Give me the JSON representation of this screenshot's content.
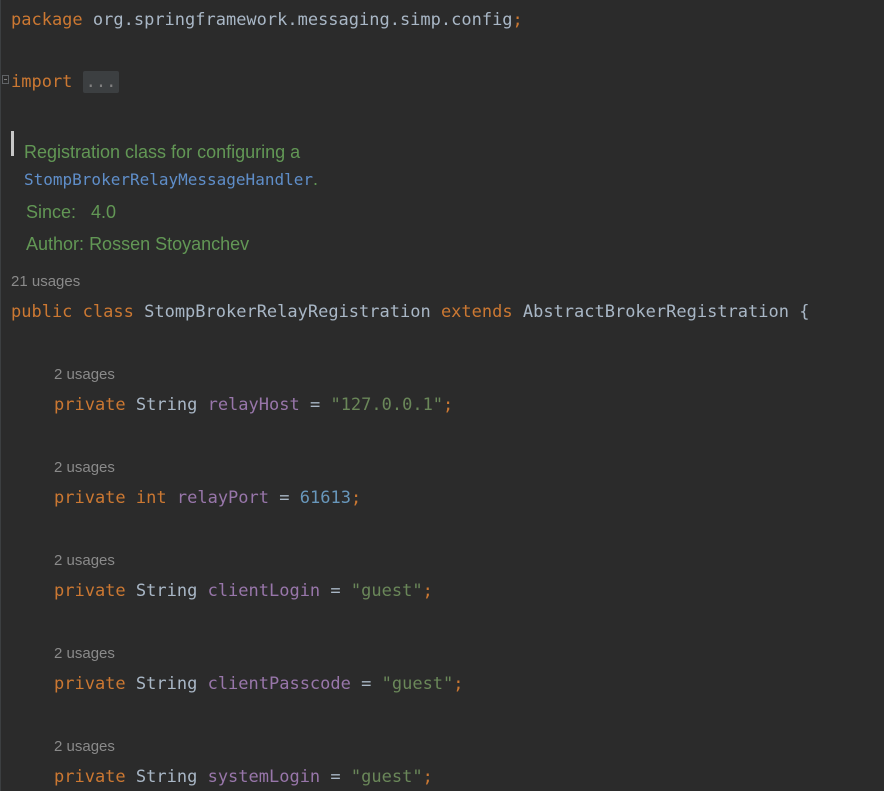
{
  "package_line": {
    "keyword": "package",
    "name": "org.springframework.messaging.simp.config",
    "semicolon": ";"
  },
  "import_line": {
    "keyword": "import",
    "collapsed": "..."
  },
  "javadoc": {
    "line1": "Registration class for configuring a",
    "link": "StompBrokerRelayMessageHandler",
    "link_suffix": ".",
    "since_label": "Since:",
    "since_value": "4.0",
    "author_label": "Author:",
    "author_value": "Rossen Stoyanchev"
  },
  "class_decl": {
    "usages": "21 usages",
    "public": "public",
    "class": "class",
    "name": "StompBrokerRelayRegistration",
    "extends": "extends",
    "parent": "AbstractBrokerRegistration",
    "brace": "{"
  },
  "fields": [
    {
      "usages": "2 usages",
      "modifier": "private",
      "type": "String",
      "type_kind": "class",
      "name": "relayHost",
      "eq": "=",
      "value": "\"127.0.0.1\"",
      "value_kind": "string",
      "semicolon": ";"
    },
    {
      "usages": "2 usages",
      "modifier": "private",
      "type": "int",
      "type_kind": "keyword",
      "name": "relayPort",
      "eq": "=",
      "value": "61613",
      "value_kind": "number",
      "semicolon": ";"
    },
    {
      "usages": "2 usages",
      "modifier": "private",
      "type": "String",
      "type_kind": "class",
      "name": "clientLogin",
      "eq": "=",
      "value": "\"guest\"",
      "value_kind": "string",
      "semicolon": ";"
    },
    {
      "usages": "2 usages",
      "modifier": "private",
      "type": "String",
      "type_kind": "class",
      "name": "clientPasscode",
      "eq": "=",
      "value": "\"guest\"",
      "value_kind": "string",
      "semicolon": ";"
    },
    {
      "usages": "2 usages",
      "modifier": "private",
      "type": "String",
      "type_kind": "class",
      "name": "systemLogin",
      "eq": "=",
      "value": "\"guest\"",
      "value_kind": "string",
      "semicolon": ";"
    }
  ],
  "colors": {
    "background": "#2b2b2b",
    "keyword": "#cc7832",
    "string": "#6a8759",
    "number": "#6897bb",
    "field": "#9876aa",
    "doc": "#629755",
    "doc_link": "#5f8ec9",
    "hint": "#8a8a8a"
  }
}
